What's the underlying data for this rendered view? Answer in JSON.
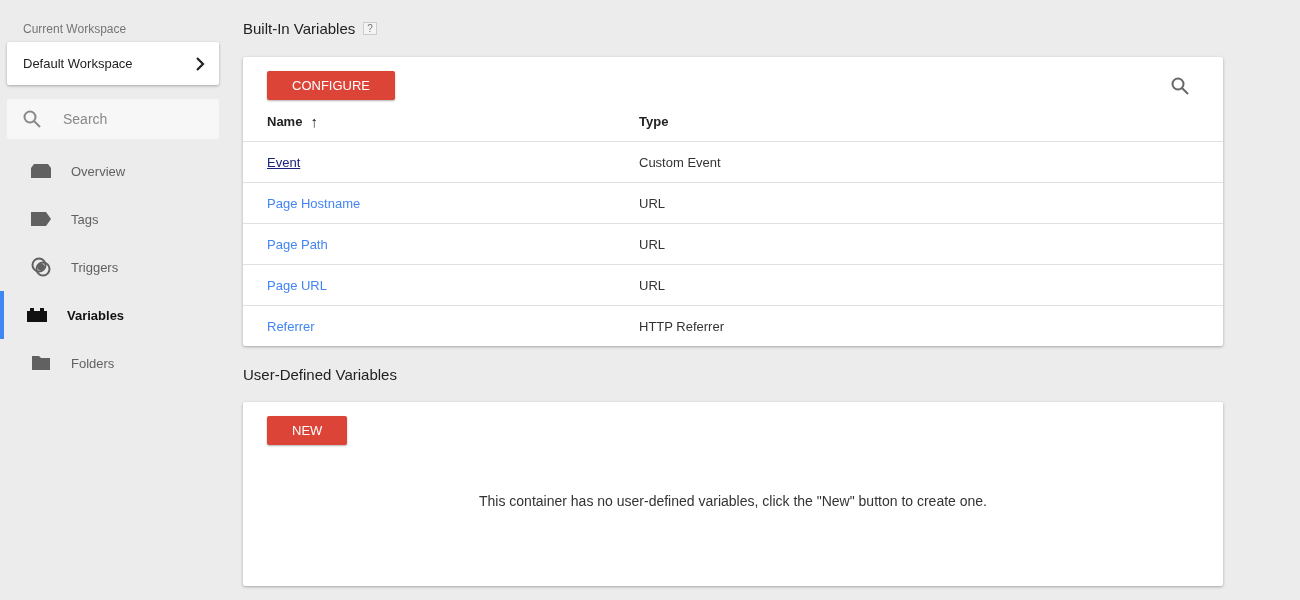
{
  "sidebar": {
    "workspace_label": "Current Workspace",
    "workspace": "Default Workspace",
    "search": {
      "placeholder": "Search"
    },
    "items": [
      {
        "label": "Overview",
        "kind": "overview",
        "selected": false
      },
      {
        "label": "Tags",
        "kind": "tag",
        "selected": false
      },
      {
        "label": "Triggers",
        "kind": "trigger",
        "selected": false
      },
      {
        "label": "Variables",
        "kind": "variable",
        "selected": true
      },
      {
        "label": "Folders",
        "kind": "folder",
        "selected": false
      }
    ]
  },
  "built_in": {
    "title": "Built-In Variables",
    "help": "?",
    "button": "CONFIGURE",
    "columns": [
      {
        "label": "Name",
        "sort": "↑"
      },
      {
        "label": "Type"
      }
    ],
    "rows": [
      {
        "name": "Event",
        "type": "Custom Event",
        "visited": true
      },
      {
        "name": "Page Hostname",
        "type": "URL",
        "visited": false
      },
      {
        "name": "Page Path",
        "type": "URL",
        "visited": false
      },
      {
        "name": "Page URL",
        "type": "URL",
        "visited": false
      },
      {
        "name": "Referrer",
        "type": "HTTP Referrer",
        "visited": false
      }
    ]
  },
  "user_defined": {
    "title": "User-Defined Variables",
    "button": "NEW",
    "empty_message": "This container has no user-defined variables, click the \"New\" button to create one."
  }
}
